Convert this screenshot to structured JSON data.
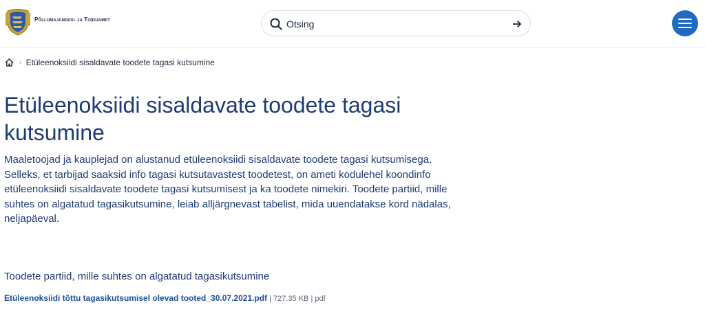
{
  "header": {
    "logo_text": "Põllumajandus- ja Toiduamet",
    "search": {
      "placeholder": "Otsing",
      "value": ""
    }
  },
  "breadcrumb": {
    "current": "Etüleenoksiidi sisaldavate toodete tagasi kutsumine"
  },
  "main": {
    "title": "Etüleenoksiidi sisaldavate toodete tagasi kutsumine",
    "intro": "Maaletoojad ja kauplejad on alustanud etüleenoksiidi sisaldavate toodete tagasi kutsumisega. Selleks, et tarbijad saaksid info tagasi kutsutavastest toodetest, on ameti kodulehel koondinfo etüleenoksiidi sisaldavate toodete tagasi kutsumisest ja ka toodete nimekiri. Toodete partiid, mille suhtes on algatatud tagasikutsumine, leiab alljärgnevast tabelist, mida uuendatakse kord nädalas, neljapäeval.",
    "subheading": "Toodete partiid, mille suhtes on algatatud tagasikutsumine",
    "file": {
      "name": "Etüleenoksiidi tõttu tagasikutsumisel olevad tooted_30.07.2021.pdf",
      "meta": "| 727.35 KB | pdf"
    }
  },
  "colors": {
    "primary_text": "#1e3b73",
    "link": "#1e4f97",
    "menu_button": "#1f6bc0"
  },
  "icons": [
    "coat-of-arms-logo",
    "search-icon",
    "arrow-right-icon",
    "hamburger-menu-icon",
    "home-icon"
  ]
}
